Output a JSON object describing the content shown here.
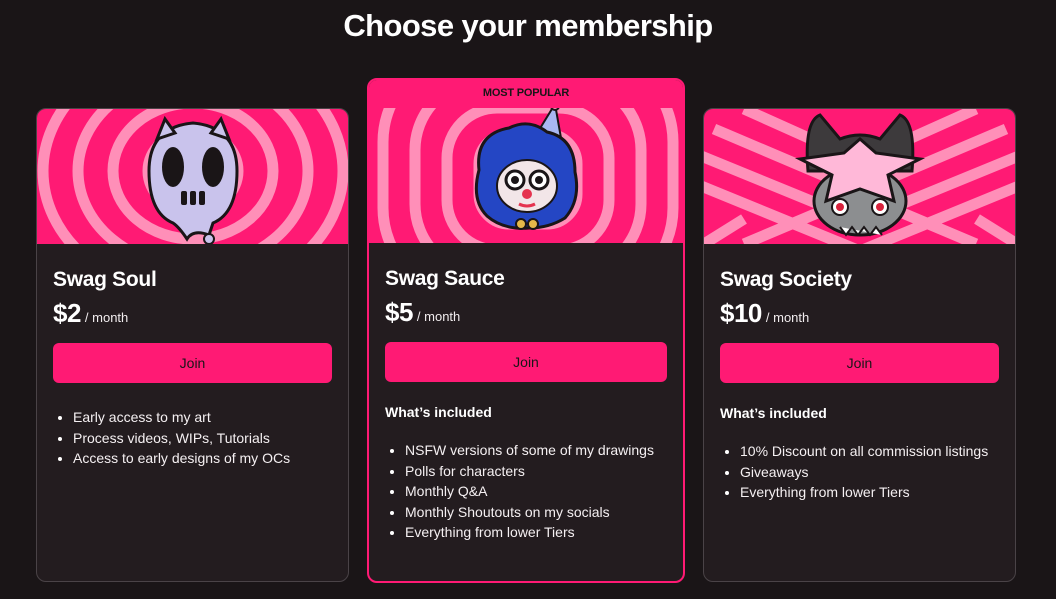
{
  "page": {
    "title": "Choose your membership"
  },
  "colors": {
    "background": "#1a1517",
    "card": "#231c1f",
    "accent": "#ff1a74",
    "banner_light": "#ff8fb8"
  },
  "tiers": [
    {
      "name": "Swag Soul",
      "price": "$2",
      "period": "/ month",
      "join_label": "Join",
      "badge": "",
      "included_title": "",
      "benefits": [
        "Early access to my art",
        "Process videos, WIPs, Tutorials",
        "Access to early designs of my OCs"
      ],
      "image_icon": "ghost-skull-mascot"
    },
    {
      "name": "Swag Sauce",
      "price": "$5",
      "period": "/ month",
      "join_label": "Join",
      "badge": "MOST POPULAR",
      "included_title": "What’s included",
      "benefits": [
        "NSFW versions of some of my drawings",
        "Polls for characters",
        "Monthly Q&A",
        "Monthly Shoutouts on my socials",
        "Everything from lower Tiers"
      ],
      "image_icon": "clown-mascot"
    },
    {
      "name": "Swag Society",
      "price": "$10",
      "period": "/ month",
      "join_label": "Join",
      "badge": "",
      "included_title": "What’s included",
      "benefits": [
        "10% Discount on all commission listings",
        "Giveaways",
        "Everything from lower Tiers"
      ],
      "image_icon": "cat-star-glasses-mascot"
    }
  ]
}
